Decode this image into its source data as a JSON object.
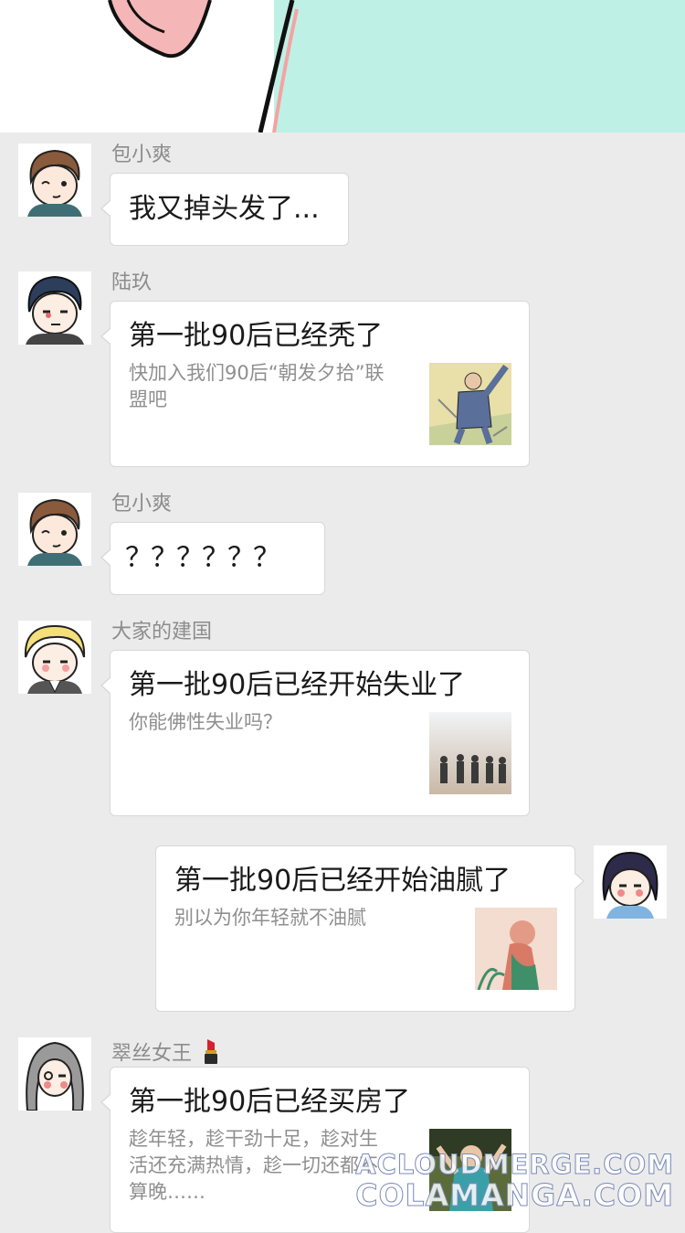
{
  "messages": [
    {
      "sender": "包小爽",
      "text": "我又掉头发了..."
    },
    {
      "sender": "陆玖",
      "title": "第一批90后已经秃了",
      "desc": "快加入我们90后“朝发夕拾”联盟吧"
    },
    {
      "sender": "包小爽",
      "text": "？？？？？？"
    },
    {
      "sender": "大家的建国",
      "title": "第一批90后已经开始失业了",
      "desc": "你能佛性失业吗？"
    },
    {
      "sender": "",
      "title": "第一批90后已经开始油腻了",
      "desc": "别以为你年轻就不油腻"
    },
    {
      "sender": "翠丝女王",
      "title": "第一批90后已经买房了",
      "desc": "趁年轻，趁干劲十足，趁对生活还充满热情，趁一切还都不算晚……"
    }
  ],
  "watermark": {
    "line1": "ACLOUDMERGE.COM",
    "line2": "COLAMANGA.COM"
  },
  "icons": [
    "lipstick-icon"
  ],
  "colors": {
    "background": "#ebebeb",
    "bubble": "#ffffff",
    "top_art_mint": "#bff0e6"
  }
}
